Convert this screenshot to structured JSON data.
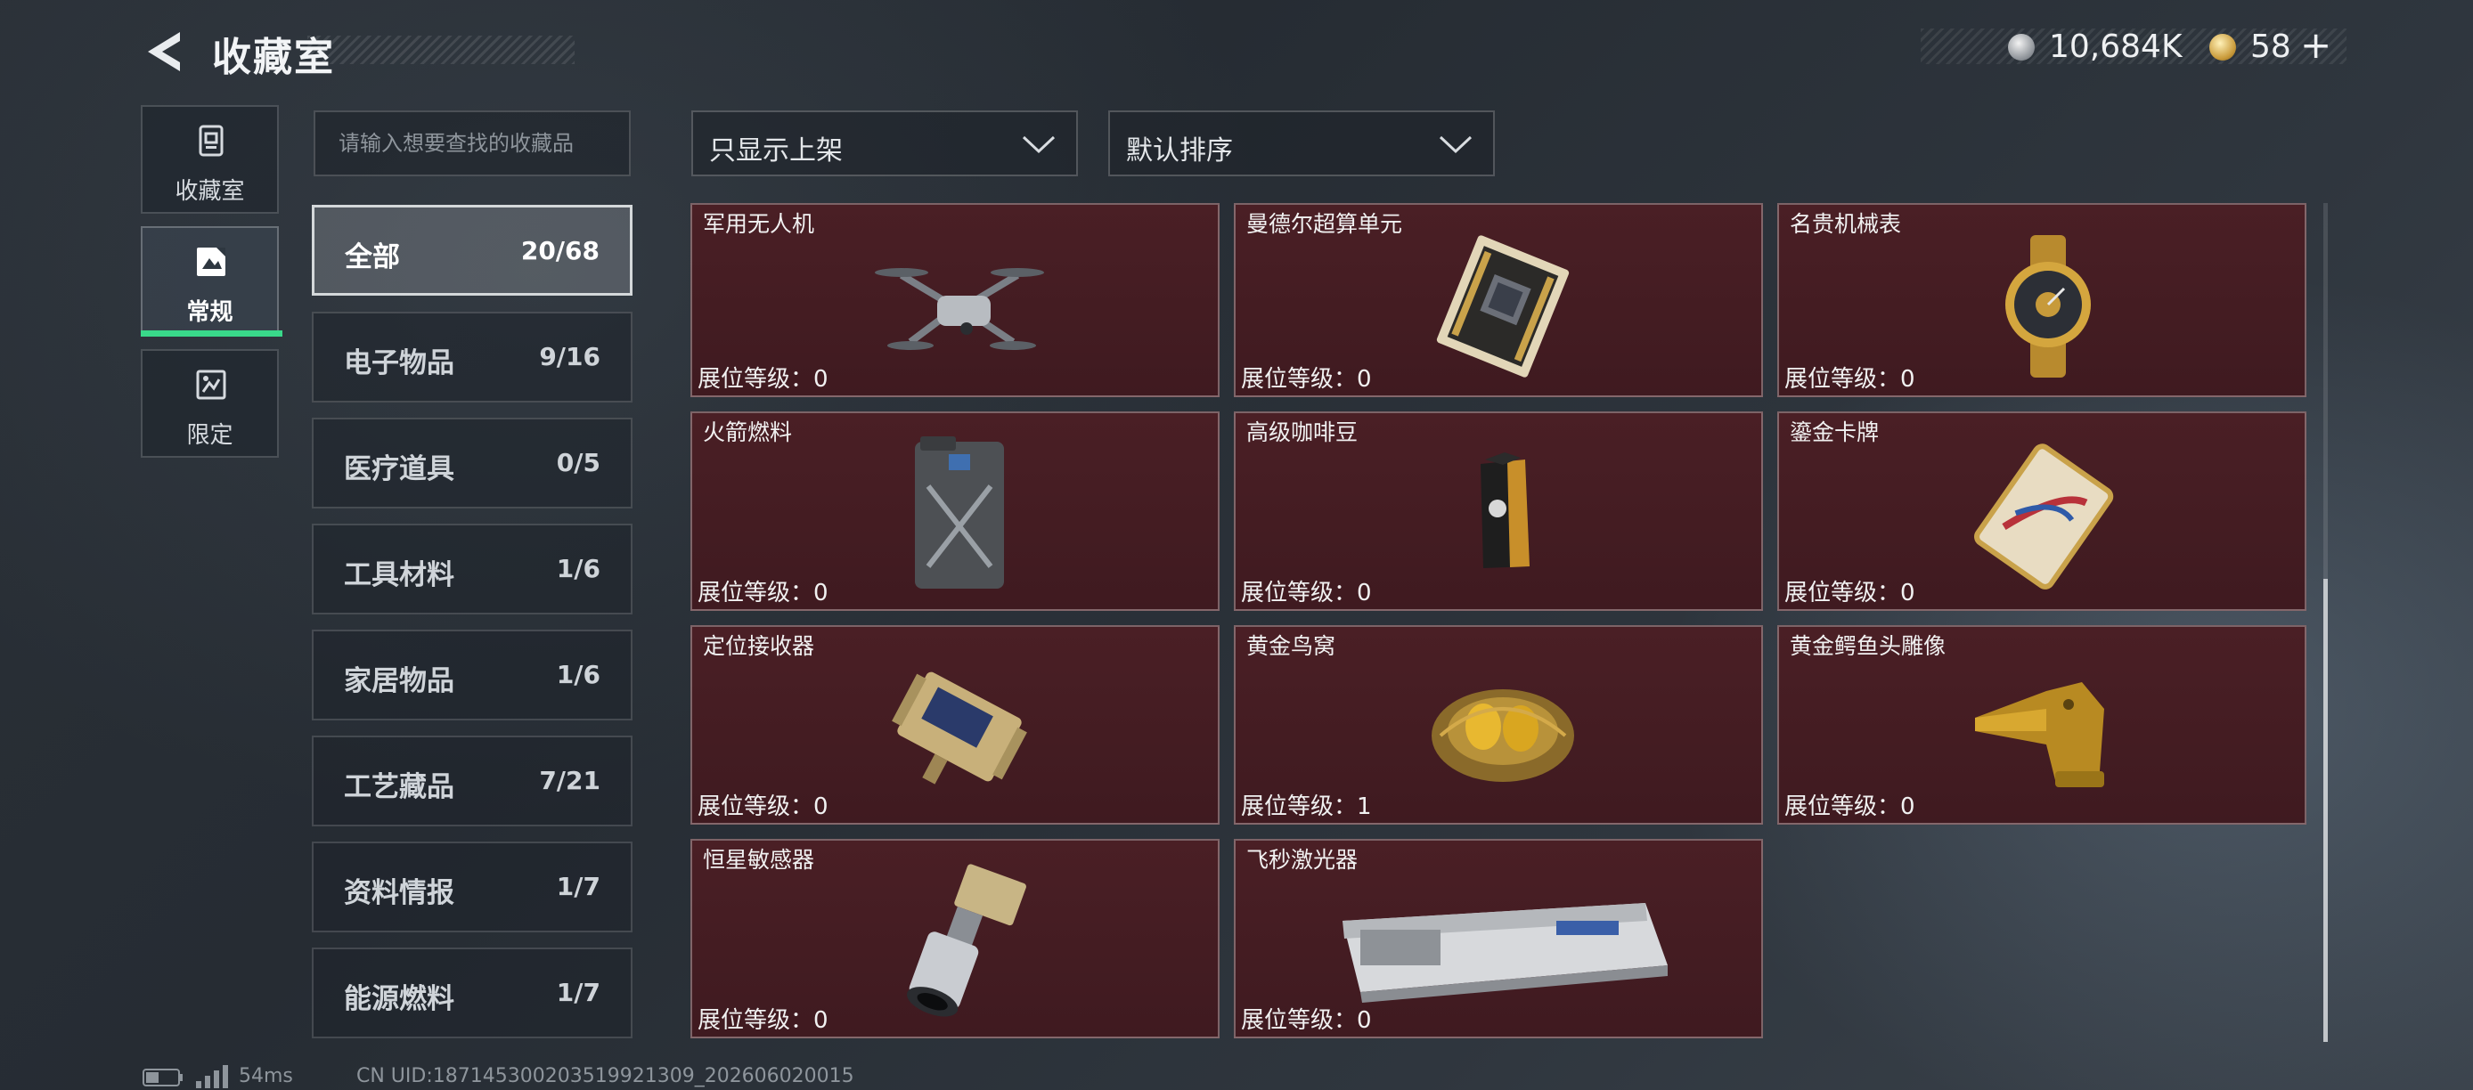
{
  "header": {
    "title": "收藏室",
    "currency_silver": "10,684K",
    "currency_gold": "58",
    "currency_plus": "+"
  },
  "nav": {
    "tabs": [
      {
        "label": "收藏室",
        "icon": "collection-room-icon"
      },
      {
        "label": "常规",
        "icon": "regular-icon",
        "active": true
      },
      {
        "label": "限定",
        "icon": "limited-icon"
      }
    ]
  },
  "search": {
    "placeholder": "请输入想要查找的收藏品",
    "value": ""
  },
  "filters": {
    "filter_label": "只显示上架",
    "sort_label": "默认排序"
  },
  "categories": [
    {
      "label": "全部",
      "count": "20/68",
      "active": true
    },
    {
      "label": "电子物品",
      "count": "9/16"
    },
    {
      "label": "医疗道具",
      "count": "0/5"
    },
    {
      "label": "工具材料",
      "count": "1/6"
    },
    {
      "label": "家居物品",
      "count": "1/6"
    },
    {
      "label": "工艺藏品",
      "count": "7/21"
    },
    {
      "label": "资料情报",
      "count": "1/7"
    },
    {
      "label": "能源燃料",
      "count": "1/7"
    }
  ],
  "items": [
    {
      "name": "军用无人机",
      "level": "展位等级：0",
      "icon": "drone-icon"
    },
    {
      "name": "曼德尔超算单元",
      "level": "展位等级：0",
      "icon": "supercomputer-unit-icon"
    },
    {
      "name": "名贵机械表",
      "level": "展位等级：0",
      "icon": "luxury-watch-icon"
    },
    {
      "name": "火箭燃料",
      "level": "展位等级：0",
      "icon": "fuel-canister-icon"
    },
    {
      "name": "高级咖啡豆",
      "level": "展位等级：0",
      "icon": "coffee-bag-icon"
    },
    {
      "name": "鎏金卡牌",
      "level": "展位等级：0",
      "icon": "gilded-card-icon"
    },
    {
      "name": "定位接收器",
      "level": "展位等级：0",
      "icon": "gps-receiver-icon"
    },
    {
      "name": "黄金鸟窝",
      "level": "展位等级：1",
      "icon": "golden-nest-icon"
    },
    {
      "name": "黄金鳄鱼头雕像",
      "level": "展位等级：0",
      "icon": "golden-crocodile-statue-icon"
    },
    {
      "name": "恒星敏感器",
      "level": "展位等级：0",
      "icon": "star-sensor-icon"
    },
    {
      "name": "飞秒激光器",
      "level": "展位等级：0",
      "icon": "femtosecond-laser-icon"
    }
  ],
  "footer": {
    "ping": "54ms",
    "uid": "CN UID:18714530020351992130​9_202606020015"
  },
  "colors": {
    "accent_green": "#39d98a",
    "card_bg": "#4a1f25",
    "gold": "#c99a3a"
  }
}
